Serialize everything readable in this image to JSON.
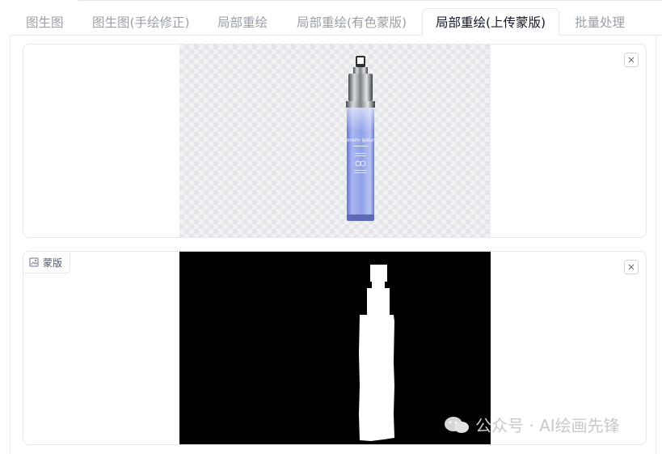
{
  "tabs": [
    {
      "label": "图生图",
      "active": false
    },
    {
      "label": "图生图(手绘修正)",
      "active": false
    },
    {
      "label": "局部重绘",
      "active": false
    },
    {
      "label": "局部重绘(有色蒙版)",
      "active": false
    },
    {
      "label": "局部重绘(上传蒙版)",
      "active": true
    },
    {
      "label": "批量处理",
      "active": false
    }
  ],
  "upload_panel": {
    "product_label_text": "Lorem ipsum",
    "close_icon": "close-icon"
  },
  "mask_panel": {
    "badge_icon": "image-icon",
    "badge_label": "蒙版",
    "close_icon": "close-icon"
  },
  "watermark": {
    "icon": "wechat-icon",
    "text": "公众号 · AI绘画先锋"
  },
  "colors": {
    "active_tab_text": "#111827",
    "inactive_tab_text": "#9aa0a8",
    "bottle_blue": "#8fa0e8",
    "mask_background": "#000000",
    "mask_shape": "#ffffff"
  }
}
